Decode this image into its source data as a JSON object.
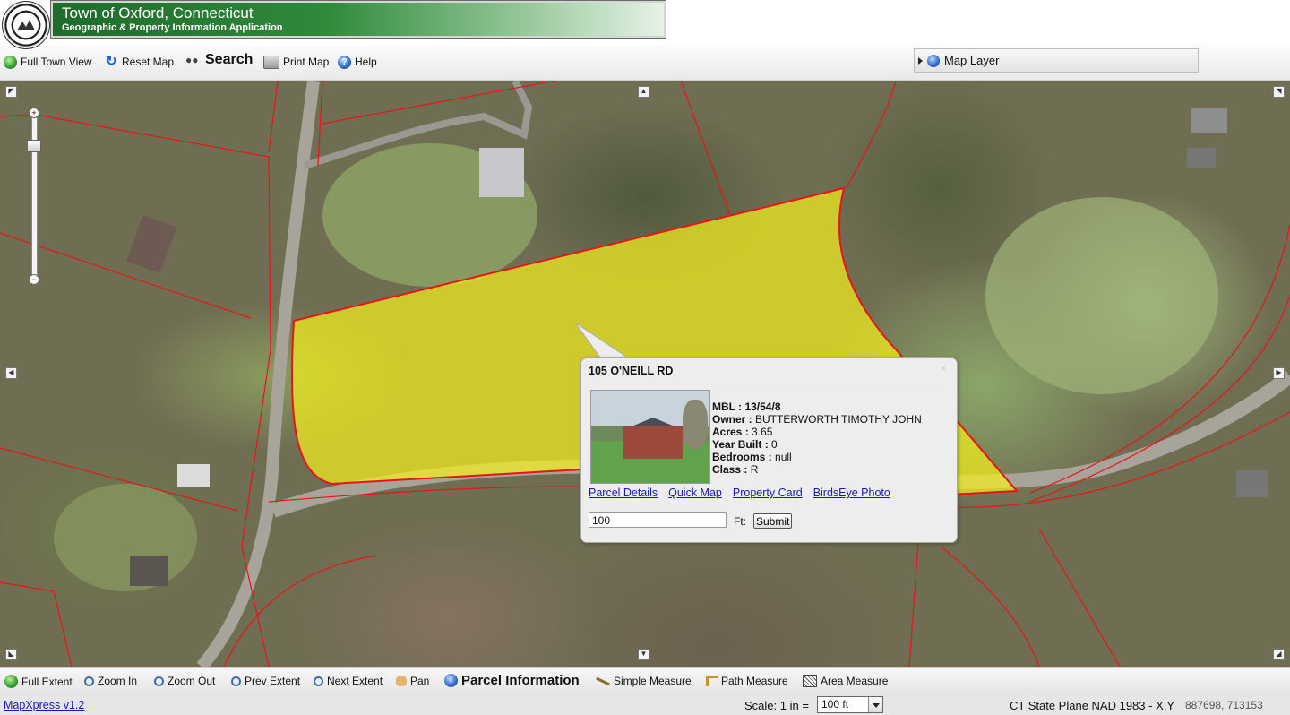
{
  "header": {
    "title": "Town of Oxford, Connecticut",
    "subtitle": "Geographic & Property Information Application"
  },
  "toolbar": {
    "full_town_view": "Full Town View",
    "reset_map": "Reset Map",
    "search": "Search",
    "print_map": "Print Map",
    "help": "Help",
    "map_layer": "Map Layer"
  },
  "popup": {
    "title": "105 O'NEILL RD",
    "close": "×",
    "mbl_label": "MBL : ",
    "mbl": "13/54/8",
    "owner_label": "Owner : ",
    "owner": "BUTTERWORTH TIMOTHY JOHN",
    "acres_label": "Acres : ",
    "acres": "3.65",
    "year_built_label": "Year Built : ",
    "year_built": "0",
    "bedrooms_label": "Bedrooms : ",
    "bedrooms": "null",
    "class_label": "Class : ",
    "class": "R",
    "links": {
      "parcel_details": "Parcel Details",
      "quick_map": "Quick Map",
      "property_card": "Property Card ",
      "birdseye_photo": "BirdsEye Photo"
    },
    "buffer_value": "100",
    "ft_label": "Ft:",
    "submit": "Submit"
  },
  "bottom_toolbar": {
    "full_extent": "Full Extent",
    "zoom_in": "Zoom In",
    "zoom_out": "Zoom Out",
    "prev_extent": "Prev Extent",
    "next_extent": "Next Extent",
    "pan": "Pan",
    "parcel_information": "Parcel Information",
    "simple_measure": "Simple Measure",
    "path_measure": "Path Measure",
    "area_measure": "Area Measure"
  },
  "status": {
    "version": "MapXpress v1.2",
    "scale_label": "Scale:  1 in =",
    "scale_value": "100 ft",
    "projection": "CT State Plane NAD 1983 - X,Y",
    "coordinates": "887698, 713153"
  },
  "colors": {
    "parcel_highlight": "#f2ef1e",
    "parcel_line": "#e8141a",
    "link": "#1a1ab5",
    "banner_green": "#2f8a3a"
  }
}
